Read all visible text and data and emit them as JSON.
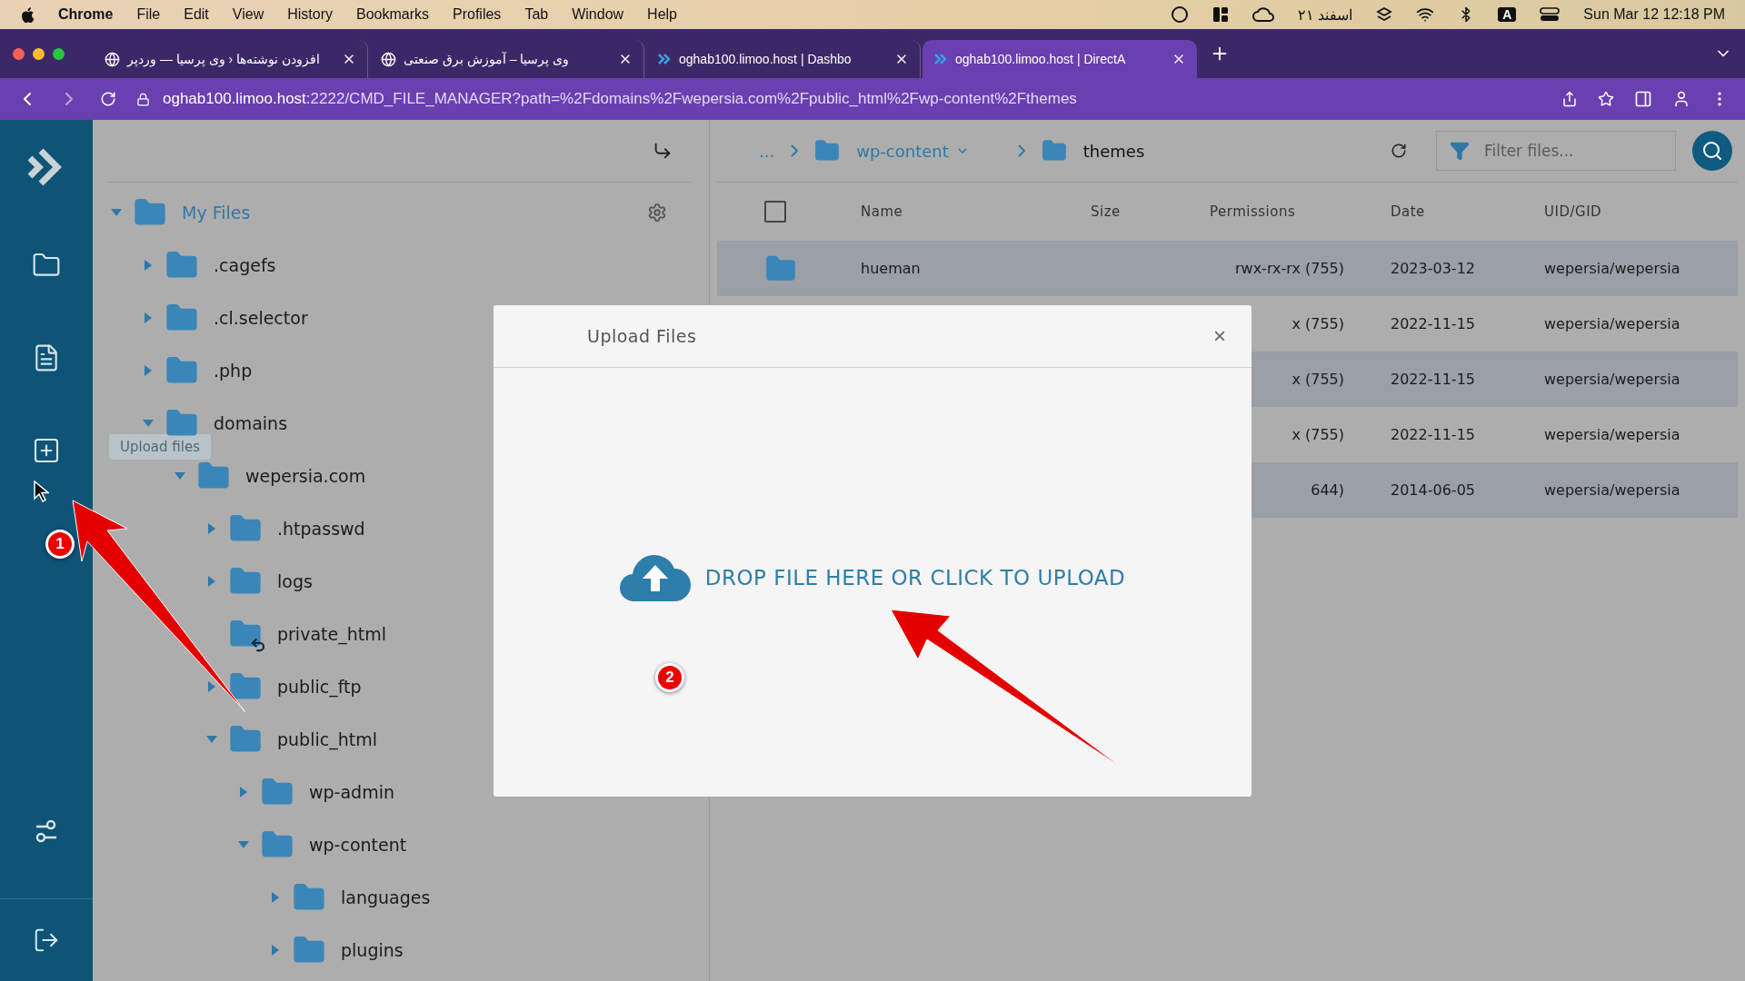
{
  "menubar": {
    "app": "Chrome",
    "menus": [
      "File",
      "Edit",
      "View",
      "History",
      "Bookmarks",
      "Profiles",
      "Tab",
      "Window",
      "Help"
    ],
    "date_persian": "۲۱ اسفند",
    "input_source": "A",
    "clock": "Sun Mar 12  12:18 PM"
  },
  "tabs": [
    {
      "title": "افزودن نوشته‌ها ‹ وی پرسیا — وردپر",
      "kind": "globe",
      "selected": false
    },
    {
      "title": "وی پرسیا – آموزش برق صنعتی",
      "kind": "globe",
      "selected": false
    },
    {
      "title": "oghab100.limoo.host | Dashbo",
      "kind": "site",
      "selected": false
    },
    {
      "title": "oghab100.limoo.host | DirectA",
      "kind": "site",
      "selected": true
    }
  ],
  "address": {
    "host": "oghab100.limoo.host",
    "rest": ":2222/CMD_FILE_MANAGER?path=%2Fdomains%2Fwepersia.com%2Fpublic_html%2Fwp-content%2Fthemes"
  },
  "sidebar": {
    "tooltip": "Upload files"
  },
  "tree": {
    "label": "My Files",
    "expanded": true,
    "children": [
      {
        "label": ".cagefs",
        "expanded": false
      },
      {
        "label": ".cl.selector",
        "expanded": false
      },
      {
        "label": ".php",
        "expanded": false
      },
      {
        "label": "domains",
        "expanded": true,
        "children": [
          {
            "label": "wepersia.com",
            "expanded": true,
            "children": [
              {
                "label": ".htpasswd",
                "expanded": false
              },
              {
                "label": "logs",
                "expanded": false
              },
              {
                "label": "private_html",
                "kind": "link"
              },
              {
                "label": "public_ftp",
                "expanded": false
              },
              {
                "label": "public_html",
                "expanded": true,
                "children": [
                  {
                    "label": "wp-admin",
                    "expanded": false
                  },
                  {
                    "label": "wp-content",
                    "expanded": true,
                    "children": [
                      {
                        "label": "languages",
                        "expanded": false
                      },
                      {
                        "label": "plugins",
                        "expanded": false
                      }
                    ]
                  }
                ]
              }
            ]
          }
        ]
      }
    ]
  },
  "breadcrumb": {
    "ellipsis": "...",
    "parent": "wp-content",
    "current": "themes"
  },
  "filter": {
    "placeholder": "Filter files..."
  },
  "table": {
    "columns": [
      "Name",
      "Size",
      "Permissions",
      "Date",
      "UID/GID"
    ],
    "checked": false,
    "rows": [
      {
        "kind": "folder",
        "name": "hueman",
        "permissions": "rwx-rx-rx (755)",
        "date": "2023-03-12",
        "owner": "wepersia/wepersia"
      },
      {
        "permissions": "x (755)",
        "date": "2022-11-15",
        "owner": "wepersia/wepersia"
      },
      {
        "permissions": "x (755)",
        "date": "2022-11-15",
        "owner": "wepersia/wepersia"
      },
      {
        "permissions": "x (755)",
        "date": "2022-11-15",
        "owner": "wepersia/wepersia"
      },
      {
        "permissions": "644)",
        "date": "2014-06-05",
        "owner": "wepersia/wepersia"
      }
    ]
  },
  "dialog": {
    "title": "Upload Files",
    "close": "×",
    "drop_text": "DROP FILE HERE OR CLICK TO UPLOAD"
  },
  "annotations": [
    {
      "number": "1"
    },
    {
      "number": "2"
    }
  ]
}
